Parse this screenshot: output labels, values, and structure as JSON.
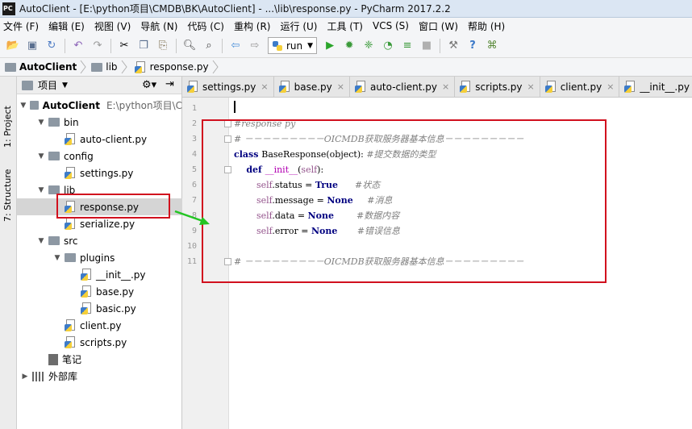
{
  "window": {
    "title": "AutoClient - [E:\\python项目\\CMDB\\BK\\AutoClient] - ...\\lib\\response.py - PyCharm 2017.2.2",
    "app_icon_text": [
      "PC",
      "PC"
    ]
  },
  "menu": [
    "文件 (F)",
    "编辑 (E)",
    "视图 (V)",
    "导航 (N)",
    "代码 (C)",
    "重构 (R)",
    "运行 (U)",
    "工具 (T)",
    "VCS (S)",
    "窗口 (W)",
    "帮助 (H)"
  ],
  "toolbar": {
    "run_config": "run"
  },
  "breadcrumb": [
    "AutoClient",
    "lib",
    "response.py"
  ],
  "side_tabs": {
    "project": "1: Project",
    "structure": "7: Structure"
  },
  "project_panel": {
    "header": "项目",
    "root_path": "E:\\python项目\\C",
    "items": [
      {
        "label": "AutoClient",
        "type": "folder",
        "depth": 0,
        "expanded": true
      },
      {
        "label": "bin",
        "type": "folder",
        "depth": 1,
        "expanded": true
      },
      {
        "label": "auto-client.py",
        "type": "py",
        "depth": 2
      },
      {
        "label": "config",
        "type": "folder",
        "depth": 1,
        "expanded": true
      },
      {
        "label": "settings.py",
        "type": "py",
        "depth": 2
      },
      {
        "label": "lib",
        "type": "folder",
        "depth": 1,
        "expanded": true
      },
      {
        "label": "response.py",
        "type": "py",
        "depth": 2,
        "selected": true
      },
      {
        "label": "serialize.py",
        "type": "py",
        "depth": 2
      },
      {
        "label": "src",
        "type": "folder",
        "depth": 1,
        "expanded": true
      },
      {
        "label": "plugins",
        "type": "folder",
        "depth": 2,
        "expanded": true
      },
      {
        "label": "__init__.py",
        "type": "py",
        "depth": 3
      },
      {
        "label": "base.py",
        "type": "py",
        "depth": 3
      },
      {
        "label": "basic.py",
        "type": "py",
        "depth": 3
      },
      {
        "label": "client.py",
        "type": "py",
        "depth": 2
      },
      {
        "label": "scripts.py",
        "type": "py",
        "depth": 2
      },
      {
        "label": "笔记",
        "type": "note",
        "depth": 1
      },
      {
        "label": "外部库",
        "type": "lib",
        "depth": 0,
        "expanded": false
      }
    ]
  },
  "editor_tabs": [
    "settings.py",
    "base.py",
    "auto-client.py",
    "scripts.py",
    "client.py",
    "__init__.py"
  ],
  "code": {
    "line_numbers": [
      "1",
      "2",
      "3",
      "4",
      "5",
      "6",
      "7",
      "8",
      "9",
      "10",
      "11"
    ],
    "lines": [
      [],
      [
        {
          "t": "#response py",
          "c": "cmt"
        }
      ],
      [
        {
          "t": "# －－－－－－－－－OICMDB获取服务器基本信息－－－－－－－－－",
          "c": "cmt"
        }
      ],
      [
        {
          "t": "class ",
          "c": "kw"
        },
        {
          "t": "BaseResponse(object): ",
          "c": ""
        },
        {
          "t": "#提交数据的类型",
          "c": "cmt"
        }
      ],
      [
        {
          "t": "    def ",
          "c": "kw"
        },
        {
          "t": "__init__",
          "c": "mag"
        },
        {
          "t": "(",
          "c": ""
        },
        {
          "t": "self",
          "c": "selfkw"
        },
        {
          "t": "):",
          "c": ""
        }
      ],
      [
        {
          "t": "        self",
          "c": "selfkw"
        },
        {
          "t": ".status = ",
          "c": ""
        },
        {
          "t": "True",
          "c": "kw"
        },
        {
          "t": "      #状态",
          "c": "cmt"
        }
      ],
      [
        {
          "t": "        self",
          "c": "selfkw"
        },
        {
          "t": ".message = ",
          "c": ""
        },
        {
          "t": "None",
          "c": "kw"
        },
        {
          "t": "     #消息",
          "c": "cmt"
        }
      ],
      [
        {
          "t": "        self",
          "c": "selfkw"
        },
        {
          "t": ".data = ",
          "c": ""
        },
        {
          "t": "None",
          "c": "kw"
        },
        {
          "t": "        #数据内容",
          "c": "cmt"
        }
      ],
      [
        {
          "t": "        self",
          "c": "selfkw"
        },
        {
          "t": ".error = ",
          "c": ""
        },
        {
          "t": "None",
          "c": "kw"
        },
        {
          "t": "       #错误信息",
          "c": "cmt"
        }
      ],
      [],
      [
        {
          "t": "# －－－－－－－－－OICMDB获取服务器基本信息－－－－－－－－－",
          "c": "cmt"
        }
      ]
    ]
  },
  "colors": {
    "highlight_box": "#d1101e",
    "arrow": "#22c522",
    "keyword": "#000080",
    "comment": "#808080"
  }
}
